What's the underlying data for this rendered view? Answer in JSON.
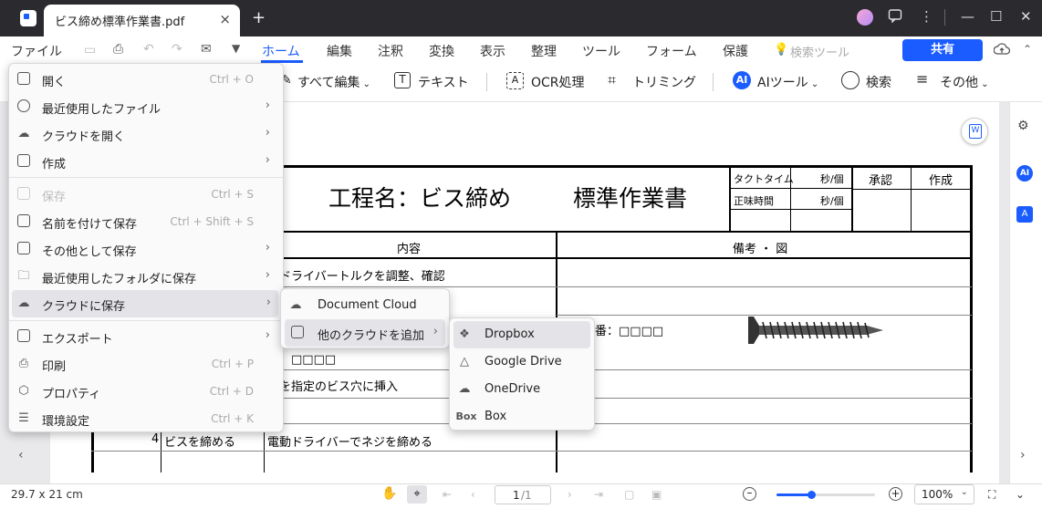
{
  "tab": {
    "title": "ビス締め標準作業書.pdf",
    "close": "×",
    "new_tab": "+"
  },
  "window": {
    "minimize": "—",
    "maximize": "☐",
    "close": "✕"
  },
  "menubar": {
    "file": "ファイル",
    "home": "ホーム",
    "edit": "編集",
    "comment": "注釈",
    "convert": "変換",
    "view": "表示",
    "organize": "整理",
    "tools": "ツール",
    "form": "フォーム",
    "protect": "保護",
    "search_tools": "検索ツール",
    "share": "共有"
  },
  "toolbar": {
    "edit_all": "すべて編集",
    "text": "テキスト",
    "ocr": "OCR処理",
    "crop": "トリミング",
    "ai_tools": "AIツール",
    "search": "検索",
    "more": "その他"
  },
  "file_menu": {
    "open": {
      "label": "開く",
      "shortcut": "Ctrl + O"
    },
    "recent_files": {
      "label": "最近使用したファイル"
    },
    "open_cloud": {
      "label": "クラウドを開く"
    },
    "create": {
      "label": "作成"
    },
    "save": {
      "label": "保存",
      "shortcut": "Ctrl + S"
    },
    "save_as": {
      "label": "名前を付けて保存",
      "shortcut": "Ctrl + Shift + S"
    },
    "save_as_other": {
      "label": "その他として保存"
    },
    "save_recent_folder": {
      "label": "最近使用したフォルダに保存"
    },
    "save_to_cloud": {
      "label": "クラウドに保存"
    },
    "export": {
      "label": "エクスポート"
    },
    "print": {
      "label": "印刷",
      "shortcut": "Ctrl + P"
    },
    "properties": {
      "label": "プロパティ",
      "shortcut": "Ctrl + D"
    },
    "preferences": {
      "label": "環境設定",
      "shortcut": "Ctrl + K"
    }
  },
  "cloud_submenu": {
    "document_cloud": "Document Cloud",
    "add_other_cloud": "他のクラウドを追加"
  },
  "other_cloud_submenu": {
    "dropbox": "Dropbox",
    "google_drive": "Google Drive",
    "onedrive": "OneDrive",
    "box": "Box",
    "box_icon_text": "Box"
  },
  "document": {
    "title_left": "工程名：ビス締め",
    "title_right": "標準作業書",
    "takt": "タクトタイム",
    "net_time": "正味時間",
    "sec_per": "秒/個",
    "approve": "承認",
    "create": "作成",
    "content_header": "内容",
    "notes_header": "備考 ・ 図",
    "row1": "動ドライバートルクを調整、確認",
    "part_no_right": "番：□□□□",
    "part_no_left": "番：□□□□",
    "row3": "スを指定のビス穴に挿入",
    "step4_no": "4",
    "step4": "ビスを締める",
    "step4_desc": "電動ドライバーでネジを締める"
  },
  "status": {
    "page_size": "29.7 x 21 cm",
    "page_current": "1",
    "page_total": "/1",
    "zoom": "100%"
  },
  "right_panel": {
    "ai": "AI"
  }
}
